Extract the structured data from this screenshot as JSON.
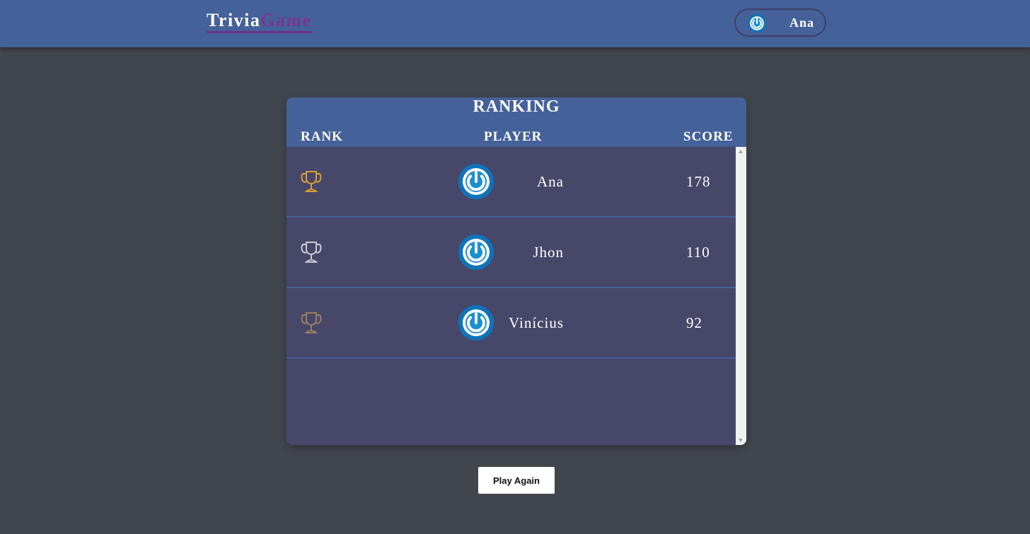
{
  "header": {
    "brand_part1": "Trivia",
    "brand_part2": "Game",
    "user_name": "Ana"
  },
  "ranking": {
    "title": "RANKING",
    "columns": {
      "rank": "RANK",
      "player": "PLAYER",
      "score": "SCORE"
    },
    "rows": [
      {
        "trophy": "gold-trophy-icon",
        "trophy_color": "#d9a032",
        "name": "Ana",
        "score": "178"
      },
      {
        "trophy": "silver-trophy-icon",
        "trophy_color": "#c9c9d0",
        "name": "Jhon",
        "score": "110"
      },
      {
        "trophy": "bronze-trophy-icon",
        "trophy_color": "#9a8060",
        "name": "Vinícius",
        "score": "92"
      }
    ]
  },
  "actions": {
    "play_again": "Play Again"
  },
  "colors": {
    "background": "#41454c",
    "header": "#45619a",
    "card": "#47476a",
    "brand_accent": "#7a3590",
    "avatar_blue": "#1177bb"
  }
}
